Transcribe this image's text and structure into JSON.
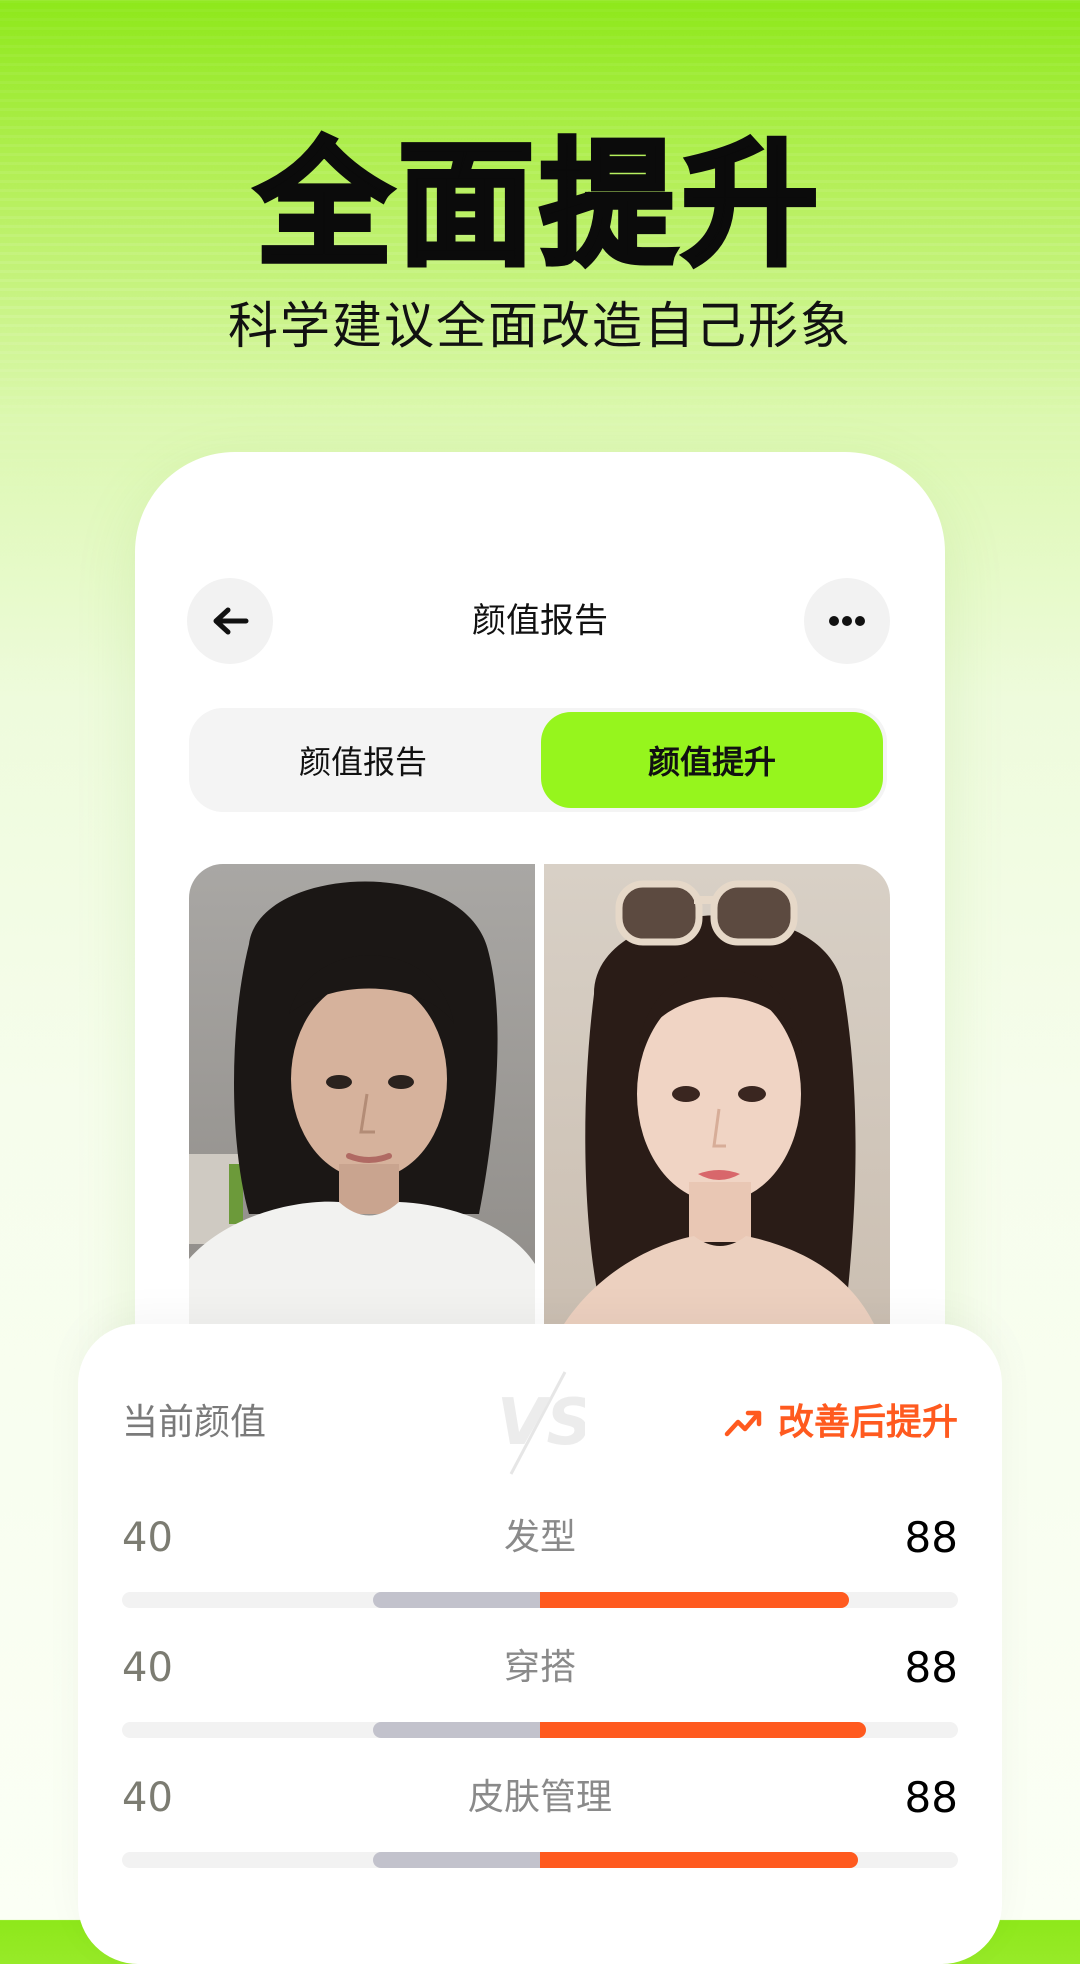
{
  "hero": {
    "title": "全面提升",
    "subtitle": "科学建议全面改造自己形象"
  },
  "header": {
    "back_icon": "arrow-left-icon",
    "title": "颜值报告",
    "more_icon": "more-dots-icon"
  },
  "tabs": [
    {
      "label": "颜值报告",
      "active": false
    },
    {
      "label": "颜值提升",
      "active": true
    }
  ],
  "photos": {
    "before": "before-photo",
    "after": "after-photo"
  },
  "comparison": {
    "current_label": "当前颜值",
    "vs_label": "VS",
    "improve_label": "改善后提升",
    "improve_icon": "trending-up-icon",
    "rows": [
      {
        "category": "发型",
        "before": "40",
        "after": "88",
        "bar_before": 0.2,
        "bar_after": 0.37
      },
      {
        "category": "穿搭",
        "before": "40",
        "after": "88",
        "bar_before": 0.2,
        "bar_after": 0.39
      },
      {
        "category": "皮肤管理",
        "before": "40",
        "after": "88",
        "bar_before": 0.2,
        "bar_after": 0.38
      }
    ]
  },
  "colors": {
    "accent_green": "#96f51d",
    "accent_orange": "#ff5a1f",
    "bar_grey": "#c2c2cc"
  }
}
